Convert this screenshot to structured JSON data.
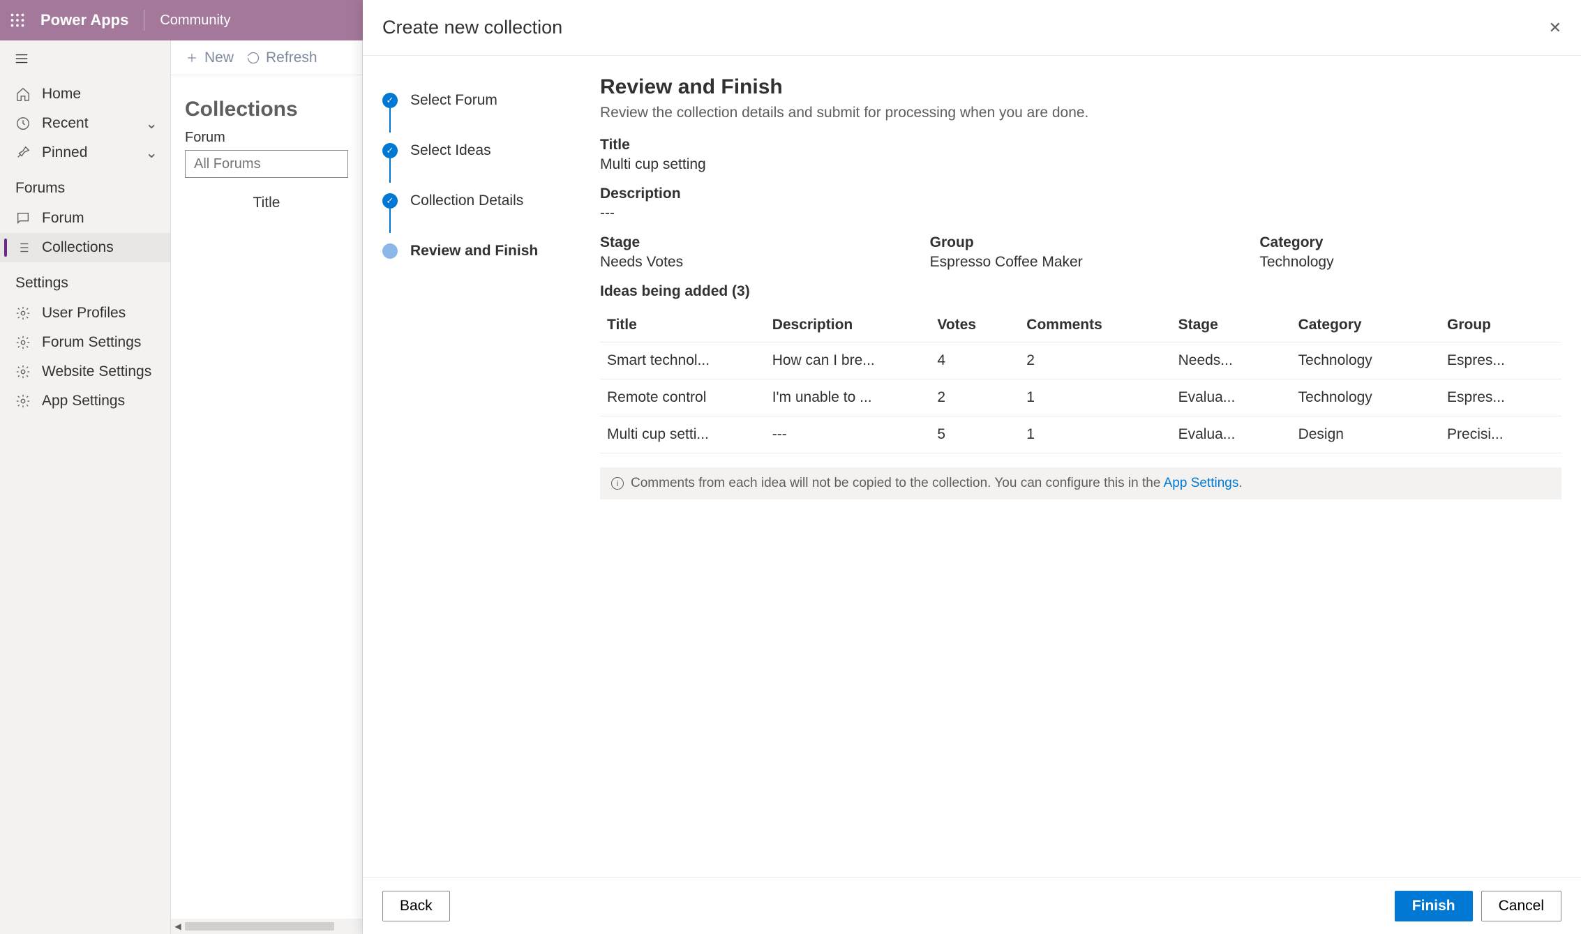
{
  "topbar": {
    "brand": "Power Apps",
    "community": "Community"
  },
  "leftnav": {
    "items_main": [
      {
        "label": "Home",
        "icon": "home"
      },
      {
        "label": "Recent",
        "icon": "clock",
        "expand": true
      },
      {
        "label": "Pinned",
        "icon": "pin",
        "expand": true
      }
    ],
    "section_forums_header": "Forums",
    "items_forums": [
      {
        "label": "Forum",
        "icon": "chat"
      },
      {
        "label": "Collections",
        "icon": "list",
        "active": true
      }
    ],
    "section_settings_header": "Settings",
    "items_settings": [
      {
        "label": "User Profiles",
        "icon": "gear"
      },
      {
        "label": "Forum Settings",
        "icon": "gear"
      },
      {
        "label": "Website Settings",
        "icon": "gear"
      },
      {
        "label": "App Settings",
        "icon": "gear"
      }
    ]
  },
  "midcol": {
    "new_label": "New",
    "refresh_label": "Refresh",
    "title": "Collections",
    "forum_label": "Forum",
    "forum_placeholder": "All Forums",
    "table_head_title": "Title"
  },
  "panel": {
    "title": "Create new collection",
    "steps": [
      {
        "label": "Select Forum",
        "state": "done"
      },
      {
        "label": "Select Ideas",
        "state": "done"
      },
      {
        "label": "Collection Details",
        "state": "done"
      },
      {
        "label": "Review and Finish",
        "state": "current"
      }
    ],
    "review": {
      "heading": "Review and Finish",
      "subtitle": "Review the collection details and submit for processing when you are done.",
      "title_k": "Title",
      "title_v": "Multi cup setting",
      "description_k": "Description",
      "description_v": "---",
      "stage_k": "Stage",
      "stage_v": "Needs Votes",
      "group_k": "Group",
      "group_v": "Espresso Coffee Maker",
      "category_k": "Category",
      "category_v": "Technology",
      "ideas_title": "Ideas being added (3)",
      "columns": {
        "title": "Title",
        "description": "Description",
        "votes": "Votes",
        "comments": "Comments",
        "stage": "Stage",
        "category": "Category",
        "group": "Group"
      },
      "rows": [
        {
          "title": "Smart technol...",
          "description": "How can I bre...",
          "votes": "4",
          "comments": "2",
          "stage": "Needs...",
          "category": "Technology",
          "group": "Espres..."
        },
        {
          "title": "Remote control",
          "description": "I'm unable to ...",
          "votes": "2",
          "comments": "1",
          "stage": "Evalua...",
          "category": "Technology",
          "group": "Espres..."
        },
        {
          "title": "Multi cup setti...",
          "description": "---",
          "votes": "5",
          "comments": "1",
          "stage": "Evalua...",
          "category": "Design",
          "group": "Precisi..."
        }
      ],
      "note_prefix": "Comments from each idea will not be copied to the collection. You can configure this in the ",
      "note_link": "App Settings",
      "note_suffix": "."
    },
    "footer": {
      "back": "Back",
      "finish": "Finish",
      "cancel": "Cancel"
    }
  }
}
